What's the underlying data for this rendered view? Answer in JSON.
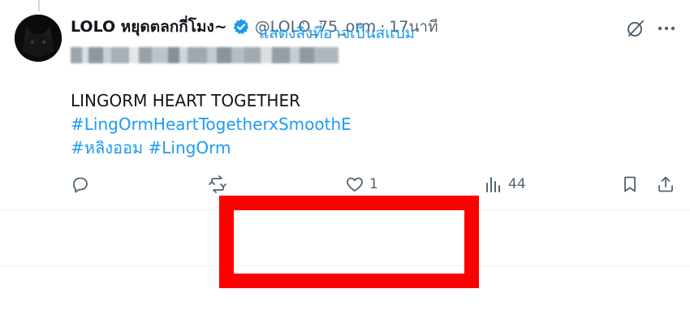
{
  "tweet": {
    "display_name": "LOLO หยุดตลกกี่โมง~",
    "handle": "@LOLO_75_orm",
    "separator": "·",
    "time": "17นาที",
    "text_line_1": "LINGORM HEART TOGETHER",
    "hashtag_line_2": "#LingOrmHeartTogetherxSmoothE",
    "hashtag_line_3": "#หลิงออม #LingOrm"
  },
  "actions": {
    "reply_icon": "reply-icon",
    "retweet_icon": "retweet-icon",
    "like_icon": "heart-icon",
    "like_count": "1",
    "views_icon": "views-icon",
    "views_count": "44",
    "bookmark_icon": "bookmark-icon",
    "share_icon": "share-icon"
  },
  "spam": {
    "label": "แสดงสิ่งที่อาจเป็นสแปม"
  },
  "colors": {
    "accent": "#1d9bf0",
    "text": "#0f1419",
    "muted": "#536471",
    "highlight": "#ff0000"
  }
}
